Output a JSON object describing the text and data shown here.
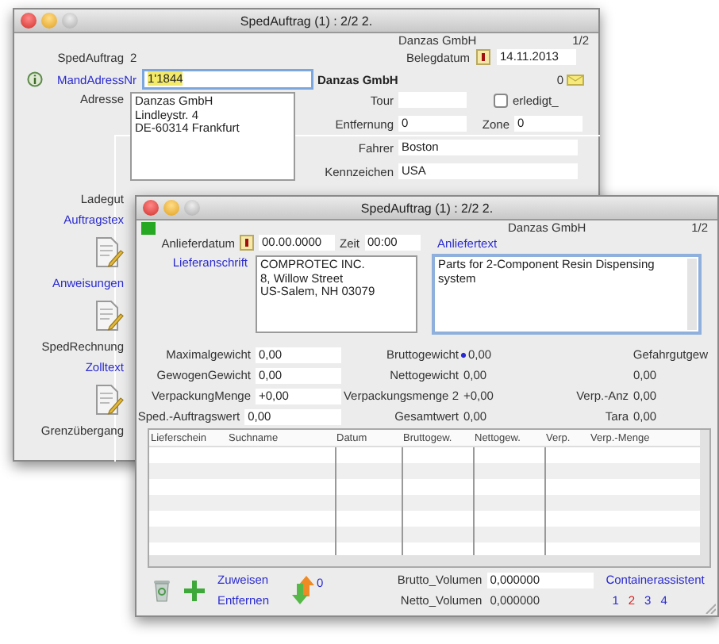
{
  "back_window": {
    "title": "SpedAuftrag (1) : 2/2 2.",
    "company": "Danzas GmbH",
    "record": "1/2",
    "order": {
      "label": "SpedAuftrag",
      "value": "2"
    },
    "date": {
      "label": "Belegdatum",
      "value": "14.11.2013"
    },
    "client": {
      "label": "MandAdressNr",
      "value": "1'1844",
      "name": "Danzas GmbH",
      "count": "0"
    },
    "address": {
      "label": "Adresse",
      "lines": [
        "Danzas GmbH",
        "Lindleystr. 4",
        "DE-60314 Frankfurt"
      ]
    },
    "tour": {
      "label": "Tour"
    },
    "done": {
      "label": "erledigt_",
      "checked": false
    },
    "distance": {
      "label": "Entfernung",
      "value": "0"
    },
    "zone": {
      "label": "Zone",
      "value": "0"
    },
    "driver": {
      "label": "Fahrer",
      "value": "Boston"
    },
    "plate": {
      "label": "Kennzeichen",
      "value": "USA"
    },
    "side_items": [
      {
        "kind": "label",
        "text": "Ladegut"
      },
      {
        "kind": "link",
        "text": "Auftragstex"
      },
      {
        "kind": "doc"
      },
      {
        "kind": "link",
        "text": "Anweisungen"
      },
      {
        "kind": "doc"
      },
      {
        "kind": "label",
        "text": "SpedRechnung"
      },
      {
        "kind": "link",
        "text": "Zolltext"
      },
      {
        "kind": "doc"
      },
      {
        "kind": "label",
        "text": "Grenzübergang"
      }
    ]
  },
  "front_window": {
    "title": "SpedAuftrag (1) : 2/2 2.",
    "company": "Danzas GmbH",
    "record": "1/2",
    "delivery_date": {
      "label": "Anlieferdatum",
      "value": "00.00.0000"
    },
    "time": {
      "label": "Zeit",
      "value": "00:00"
    },
    "delivery_text": {
      "label": "Anliefertext",
      "value": "Parts for 2-Component Resin Dispensing system"
    },
    "ship_to": {
      "label": "Lieferanschrift",
      "lines": [
        "COMPROTEC INC.",
        "8, Willow Street",
        "US-Salem, NH 03079"
      ]
    },
    "weights": [
      {
        "label": "Maximalgewicht",
        "value": "0,00"
      },
      {
        "label": "GewogenGewicht",
        "value": "0,00"
      },
      {
        "label": "VerpackungMenge",
        "value": "+0,00"
      },
      {
        "label": "Sped.-Auftragswert",
        "value": "0,00"
      }
    ],
    "totals": [
      {
        "label": "Bruttogewicht",
        "value": "0,00",
        "flagged": true
      },
      {
        "label": "Nettogewicht",
        "value": "0,00",
        "flagged": false
      },
      {
        "label": "Verpackungsmenge 2",
        "value": "+0,00",
        "flagged": false
      },
      {
        "label": "Gesamtwert",
        "value": "0,00",
        "flagged": false
      }
    ],
    "extras": [
      {
        "label": "Gefahrgutgew"
      },
      {
        "value": "0,00"
      },
      {
        "label": "Verp.-Anz",
        "value": "0,00"
      },
      {
        "label": "Tara",
        "value": "0,00"
      }
    ],
    "table": {
      "columns": [
        "Lieferschein",
        "Suchname",
        "Datum",
        "Bruttogew.",
        "Nettogew.",
        "Verp.",
        "Verp.-Menge"
      ]
    },
    "actions": [
      "Zuweisen",
      "Entfernen"
    ],
    "count": "0",
    "volumes": [
      {
        "label": "Brutto_Volumen",
        "value": "0,000000"
      },
      {
        "label": "Netto_Volumen",
        "value": "0,000000"
      }
    ],
    "assistant": "Containerassistent",
    "pages": [
      {
        "label": "1",
        "selected": false
      },
      {
        "label": "2",
        "selected": true
      },
      {
        "label": "3",
        "selected": false
      },
      {
        "label": "4",
        "selected": false
      }
    ]
  }
}
